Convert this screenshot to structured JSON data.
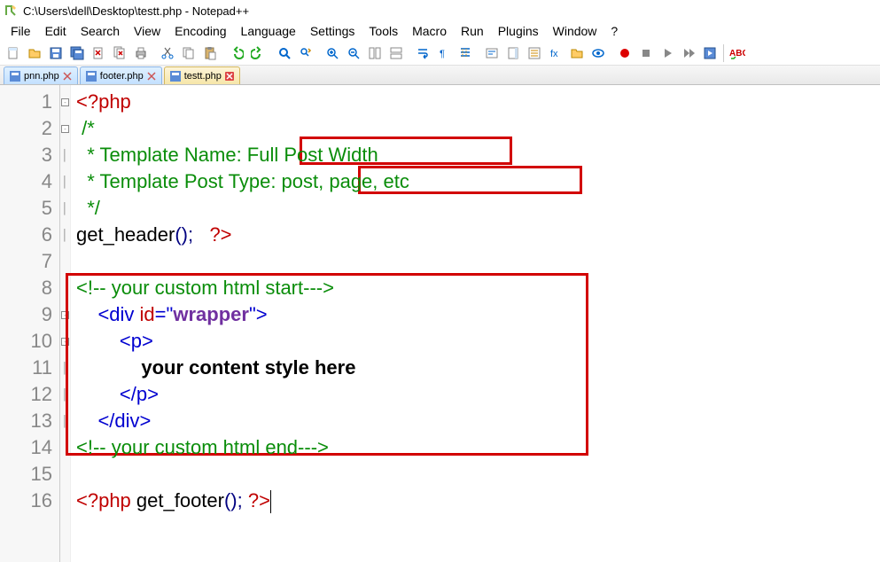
{
  "window": {
    "title": "C:\\Users\\dell\\Desktop\\testt.php - Notepad++"
  },
  "menu": {
    "items": [
      "File",
      "Edit",
      "Search",
      "View",
      "Encoding",
      "Language",
      "Settings",
      "Tools",
      "Macro",
      "Run",
      "Plugins",
      "Window",
      "?"
    ]
  },
  "tabs": {
    "items": [
      {
        "label": "pnn.php",
        "active": false
      },
      {
        "label": "footer.php",
        "active": false
      },
      {
        "label": "testt.php",
        "active": true
      }
    ]
  },
  "code": {
    "l1_a": "<?php",
    "l2_a": " /*",
    "l3_a": "  * Template Name: ",
    "l3_b": "Full Post Width",
    "l4_a": "  * Template Post Type: ",
    "l4_b": "post, page, etc",
    "l5_a": "  */",
    "l6_a": "get_header",
    "l6_b": "();   ",
    "l6_c": "?>",
    "l8_a": "<!-- your custom html start--->",
    "l9_a": "    <",
    "l9_b": "div ",
    "l9_c": "id",
    "l9_d": "=\"",
    "l9_e": "wrapper",
    "l9_f": "\">",
    "l10_a": "        <",
    "l10_b": "p",
    "l10_c": ">",
    "l11_a": "            ",
    "l11_b": "your content style here",
    "l12_a": "        </",
    "l12_b": "p",
    "l12_c": ">",
    "l13_a": "    </",
    "l13_b": "div",
    "l13_c": ">",
    "l14_a": "<!-- your custom html end--->",
    "l16_a": "<?php",
    "l16_b": " get_footer",
    "l16_c": "(); ",
    "l16_d": "?>"
  },
  "line_numbers": [
    "1",
    "2",
    "3",
    "4",
    "5",
    "6",
    "7",
    "8",
    "9",
    "10",
    "11",
    "12",
    "13",
    "14",
    "15",
    "16"
  ]
}
